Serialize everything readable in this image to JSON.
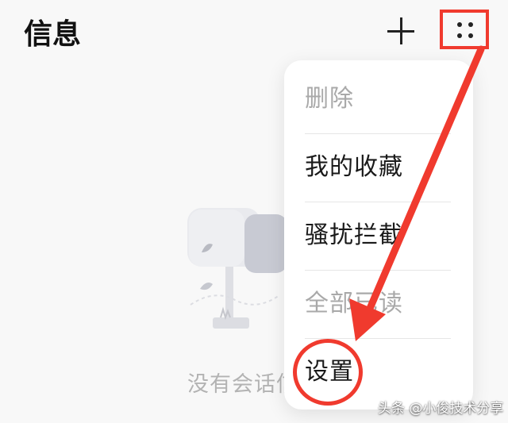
{
  "header": {
    "title": "信息",
    "add_icon": "plus-icon",
    "more_icon": "four-dot-grid-icon"
  },
  "empty_state": {
    "text": "没有会话信",
    "illustration_icon": "mailbox-icon"
  },
  "menu": {
    "items": [
      {
        "label": "删除",
        "enabled": false
      },
      {
        "label": "我的收藏",
        "enabled": true
      },
      {
        "label": "骚扰拦截",
        "enabled": true
      },
      {
        "label": "全部已读",
        "enabled": false
      },
      {
        "label": "设置",
        "enabled": true
      }
    ]
  },
  "annotation": {
    "color": "#f03a2e"
  },
  "watermark": "头条 @小俊技术分享"
}
